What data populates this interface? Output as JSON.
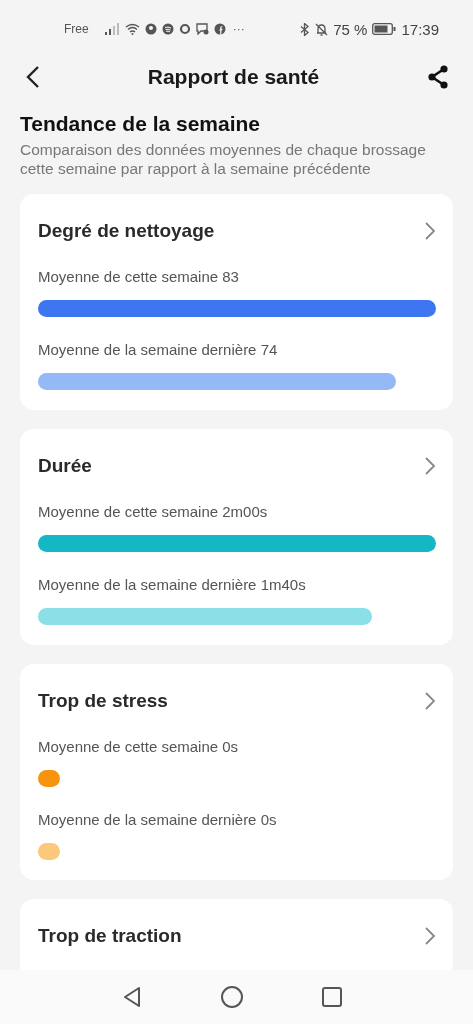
{
  "status_bar": {
    "carrier": "Free",
    "more": "···",
    "battery": "75 %",
    "time": "17:39"
  },
  "header": {
    "title": "Rapport de santé"
  },
  "section": {
    "title": "Tendance de la semaine",
    "subtitle": "Comparaison des données moyennes de chaque brossage cette semaine par rapport à la semaine précédente"
  },
  "cards": [
    {
      "title": "Degré de nettoyage",
      "rows": [
        {
          "label": "Moyenne de cette semaine 83",
          "color": "#3d76f0"
        },
        {
          "label": "Moyenne de la semaine dernière 74",
          "color": "#95b9f7"
        }
      ]
    },
    {
      "title": "Durée",
      "rows": [
        {
          "label": "Moyenne de cette semaine 2m00s",
          "color": "#14b8c4"
        },
        {
          "label": "Moyenne de la semaine dernière 1m40s",
          "color": "#8ae0e6"
        }
      ]
    },
    {
      "title": "Trop de stress",
      "rows": [
        {
          "label": "Moyenne de cette semaine 0s",
          "color": "#f7930e"
        },
        {
          "label": "Moyenne de la semaine dernière 0s",
          "color": "#fbc87c"
        }
      ]
    },
    {
      "title": "Trop de traction"
    }
  ]
}
